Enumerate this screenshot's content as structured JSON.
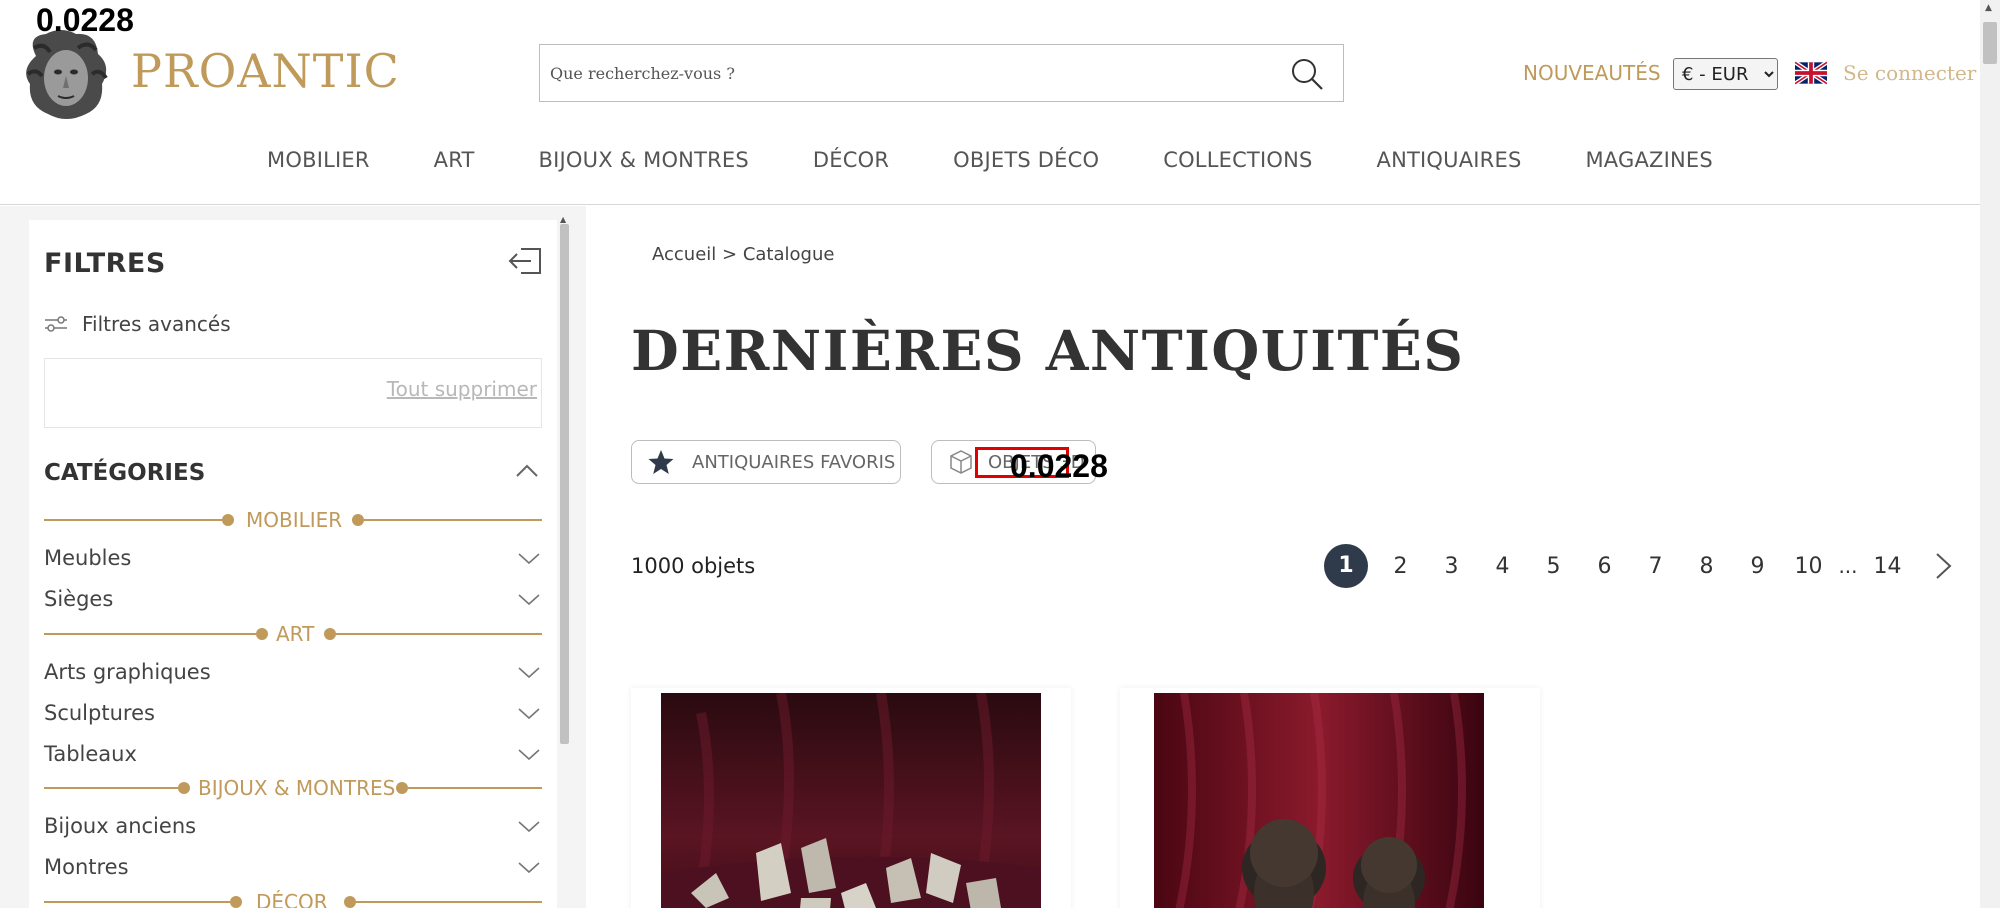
{
  "overlay": {
    "top_value": "0.0228",
    "mid_value": "0.0228"
  },
  "header": {
    "logo_text": "PROANTIC",
    "search_placeholder": "Que recherchez-vous ?",
    "nouveautes": "NOUVEAUTÉS",
    "currency": "€ - EUR",
    "connect": "Se connecter"
  },
  "nav": {
    "items": [
      "MOBILIER",
      "ART",
      "BIJOUX & MONTRES",
      "DÉCOR",
      "OBJETS DÉCO",
      "COLLECTIONS",
      "ANTIQUAIRES",
      "MAGAZINES"
    ]
  },
  "sidebar": {
    "title": "FILTRES",
    "advanced": "Filtres avancés",
    "clear_all": "Tout supprimer",
    "categories_title": "CATÉGORIES",
    "groups": [
      {
        "label": "MOBILIER",
        "items": [
          "Meubles",
          "Sièges"
        ]
      },
      {
        "label": "ART",
        "items": [
          "Arts graphiques",
          "Sculptures",
          "Tableaux"
        ]
      },
      {
        "label": "BIJOUX & MONTRES",
        "items": [
          "Bijoux anciens",
          "Montres"
        ]
      },
      {
        "label": "DÉCOR",
        "items": []
      }
    ]
  },
  "main": {
    "breadcrumb": {
      "home": "Accueil",
      "separator": " > ",
      "current": "Catalogue"
    },
    "title": "DERNIÈRES ANTIQUITÉS",
    "chips": {
      "favorites": "ANTIQUAIRES FAVORIS",
      "objects": "OBJETS 3D"
    },
    "count": "1000 objets",
    "pagination": {
      "pages": [
        "1",
        "2",
        "3",
        "4",
        "5",
        "6",
        "7",
        "8",
        "9",
        "10"
      ],
      "ellipsis": "...",
      "last": "14",
      "current": "1"
    }
  },
  "colors": {
    "brand_gold": "#c09a5b",
    "pager_active": "#2f3a4a",
    "highlight_box": "#e00000"
  }
}
